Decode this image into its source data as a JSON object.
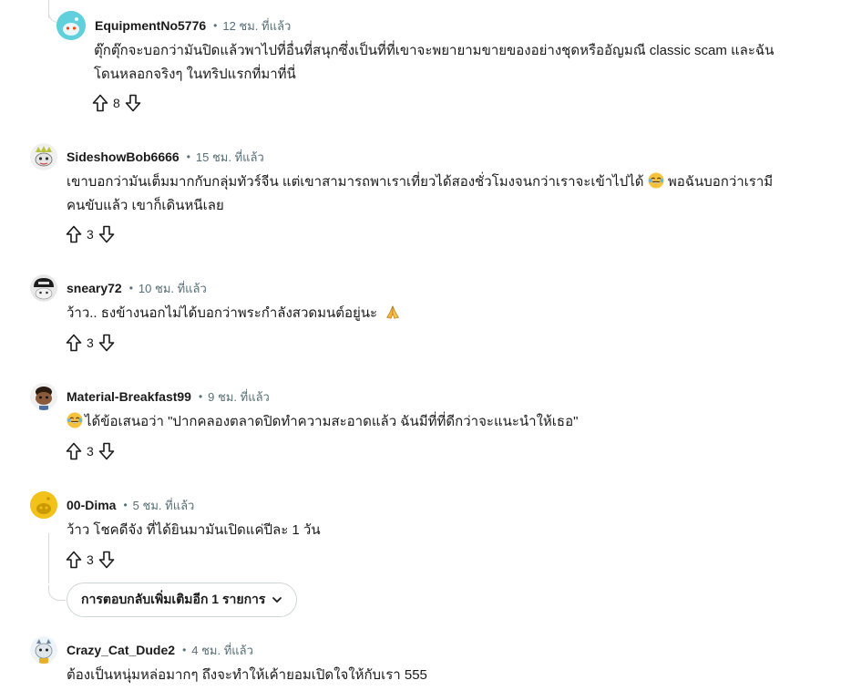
{
  "comments": [
    {
      "username": "EquipmentNo5776",
      "time": "12 ชม. ที่แล้ว",
      "lines": [
        "ตุ๊กตุ๊กจะบอกว่ามันปิดแล้วพาไปที่อื่นที่สนุกซึ่งเป็นที่ที่เขาจะพยายามขายของอย่างชุดหรืออัญมณี classic scam และฉัน",
        "โดนหลอกจริงๆ ในทริปแรกที่มาที่นี่"
      ],
      "votes": "8",
      "avatar": "snoo-teal"
    },
    {
      "username": "SideshowBob6666",
      "time": "15 ชม. ที่แล้ว",
      "line1_before": "เขาบอกว่ามันเต็มมากกับกลุ่มทัวร์จีน แต่เขาสามารถพาเราเที่ยวได้สองชั่วโมงจนกว่าเราจะเข้าไปได้",
      "line1_after": "พอฉันบอกว่าเรามี",
      "line2": "คนขับแล้ว เขาก็เดินหนีเลย",
      "votes": "3",
      "emoji": "tears-of-joy"
    },
    {
      "username": "sneary72",
      "time": "10 ชม. ที่แล้ว",
      "text": "ว้าว.. ธงข้างนอกไม่ได้บอกว่าพระกำลังสวดมนต์อยู่นะ",
      "votes": "3",
      "emoji": "folded-hands"
    },
    {
      "username": "Material-Breakfast99",
      "time": "9 ชม. ที่แล้ว",
      "text": "ได้ข้อเสนอว่า \"ปากคลองตลาดปิดทำความสะอาดแล้ว ฉันมีที่ที่ดีกว่าจะแนะนำให้เธอ\"",
      "votes": "3",
      "emoji": "tears-of-joy"
    },
    {
      "username": "00-Dima",
      "time": "5 ชม. ที่แล้ว",
      "text": "ว้าว โชคดีจัง ที่ได้ยินมามันเปิดแค่ปีละ 1 วัน",
      "votes": "3"
    },
    {
      "username": "Crazy_Cat_Dude2",
      "time": "4 ชม. ที่แล้ว",
      "text": "ต้องเป็นหนุ่มหล่อมากๆ ถึงจะทำให้เค้ายอมเปิดใจให้กับเรา 555"
    }
  ],
  "more_replies_label": "การตอบกลับเพิ่มเติมอีก 1 รายการ",
  "separator": "•",
  "colors": {
    "meta": "#576f76",
    "border": "#d7dadc",
    "text": "#1a1a1b"
  }
}
